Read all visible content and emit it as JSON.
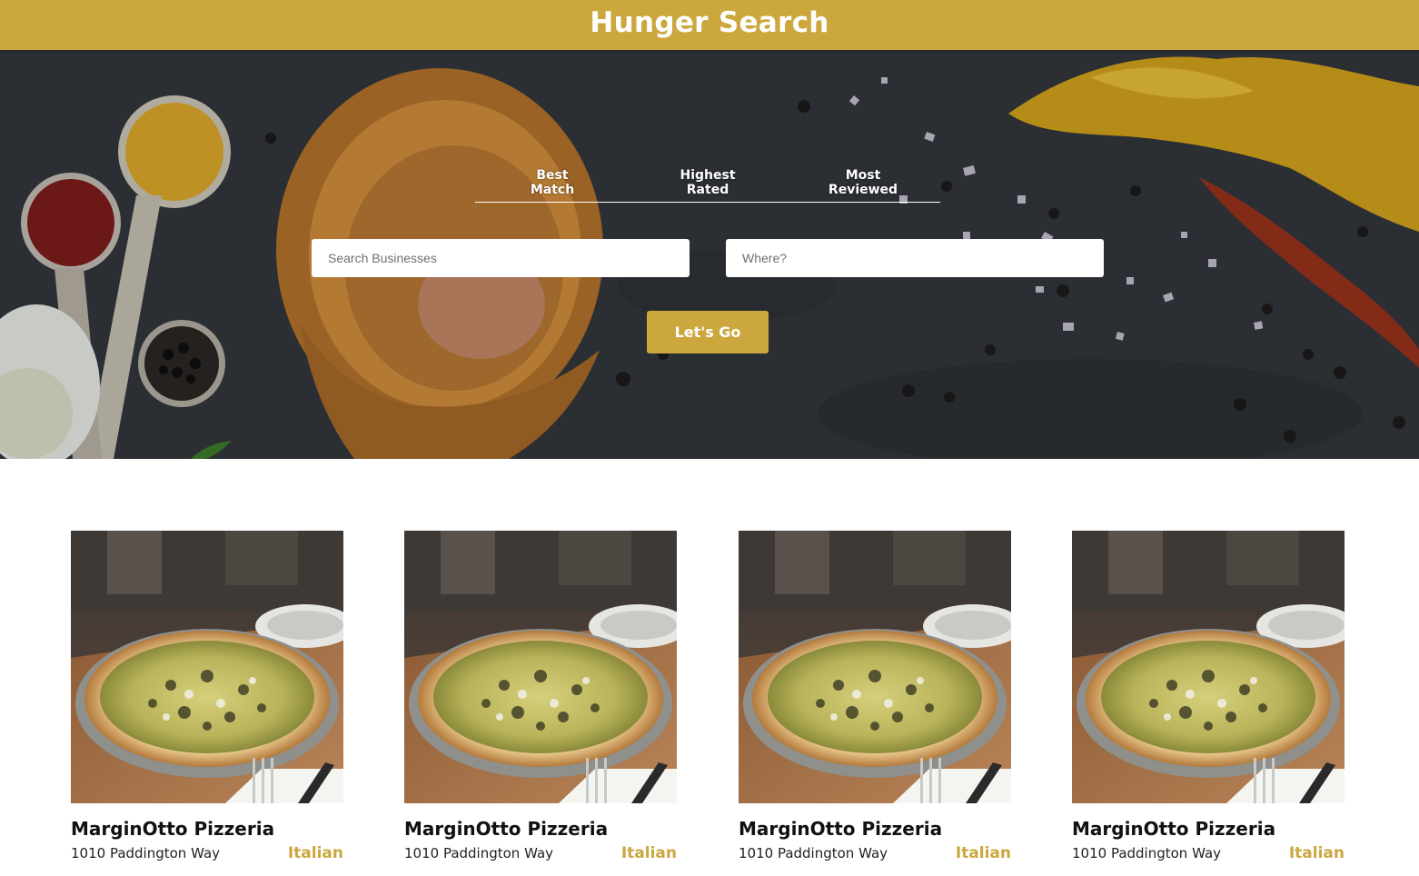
{
  "header": {
    "title": "Hunger Search"
  },
  "sort_options": [
    {
      "line1": "Best",
      "line2": "Match"
    },
    {
      "line1": "Highest",
      "line2": "Rated"
    },
    {
      "line1": "Most",
      "line2": "Reviewed"
    }
  ],
  "search": {
    "business_placeholder": "Search Businesses",
    "business_value": "",
    "location_placeholder": "Where?",
    "location_value": "",
    "submit_label": "Let's Go"
  },
  "businesses": [
    {
      "name": "MarginOtto Pizzeria",
      "address": "1010 Paddington Way",
      "category": "Italian"
    },
    {
      "name": "MarginOtto Pizzeria",
      "address": "1010 Paddington Way",
      "category": "Italian"
    },
    {
      "name": "MarginOtto Pizzeria",
      "address": "1010 Paddington Way",
      "category": "Italian"
    },
    {
      "name": "MarginOtto Pizzeria",
      "address": "1010 Paddington Way",
      "category": "Italian"
    }
  ],
  "colors": {
    "accent": "#cca73e",
    "hero_background": "#33383d",
    "text_dark": "#111111"
  },
  "images": {
    "hero": "spices-and-wooden-spoons-on-slate",
    "card": "pizza-on-table"
  }
}
